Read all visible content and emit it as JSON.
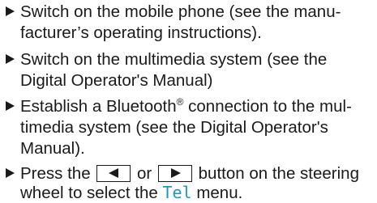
{
  "steps": [
    {
      "lines": [
        "Switch on the mobile phone (see the manu-",
        "facturer’s operating instructions)."
      ]
    },
    {
      "lines": [
        "Switch on the multimedia system (see the",
        "Digital Operator's Manual)"
      ]
    },
    {
      "line1_before_sup": "Establish a Bluetooth",
      "sup": "®",
      "line1_after_sup": " connection to the mul-",
      "lines_rest": [
        "timedia system (see the Digital Operator's",
        "Manual)."
      ]
    },
    {
      "press": "Press the",
      "or": "or",
      "after_buttons": "button on the steering",
      "line2_before_menu": "wheel to select the",
      "menu_name": "Tel",
      "line2_after_menu": " menu.",
      "left_key_icon": "left-triangle",
      "right_key_icon": "right-triangle"
    }
  ],
  "colors": {
    "text": "#1a1a1a",
    "menu_accent": "#1b96c8"
  }
}
